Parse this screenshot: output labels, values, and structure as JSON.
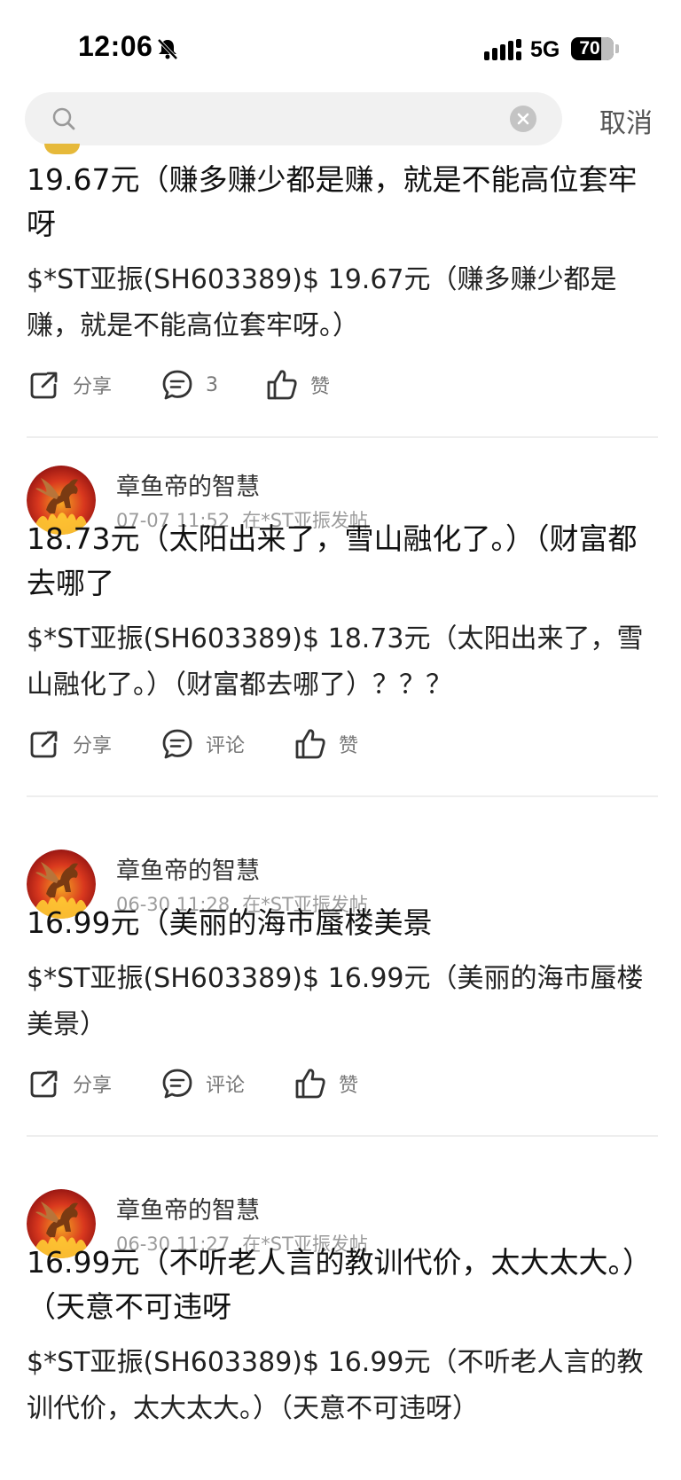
{
  "status": {
    "time": "12:06",
    "network": "5G",
    "battery": "70",
    "battery_level": 0.7
  },
  "search": {
    "placeholder": "",
    "cancel_label": "取消"
  },
  "posts": [
    {
      "title": "19.67元（赚多赚少都是赚，就是不能高位套牢呀",
      "body": "$*ST亚振(SH603389)$ 19.67元（赚多赚少都是赚，就是不能高位套牢呀。）",
      "share_label": "分享",
      "comment_label": "3",
      "like_label": "赞"
    },
    {
      "author": "章鱼帝的智慧",
      "date": "07-07 11:52",
      "location": "在*ST亚振发帖",
      "title": "18.73元（太阳出来了，雪山融化了。）（财富都去哪了",
      "body": "$*ST亚振(SH603389)$ 18.73元（太阳出来了，雪山融化了。）（财富都去哪了）？？？",
      "share_label": "分享",
      "comment_label": "评论",
      "like_label": "赞"
    },
    {
      "author": "章鱼帝的智慧",
      "date": "06-30 11:28",
      "location": "在*ST亚振发帖",
      "title": "16.99元（美丽的海市蜃楼美景",
      "body": "$*ST亚振(SH603389)$ 16.99元（美丽的海市蜃楼美景）",
      "share_label": "分享",
      "comment_label": "评论",
      "like_label": "赞"
    },
    {
      "author": "章鱼帝的智慧",
      "date": "06-30 11:27",
      "location": "在*ST亚振发帖",
      "title": "16.99元（不听老人言的教训代价，太大太大。）（天意不可违呀",
      "body": "$*ST亚振(SH603389)$ 16.99元（不听老人言的教训代价，太大太大。）（天意不可违呀）"
    }
  ],
  "colors": {
    "text": "#111111",
    "meta": "#9b9b9b",
    "action": "#777777",
    "search_bg": "#f1f1f1"
  }
}
